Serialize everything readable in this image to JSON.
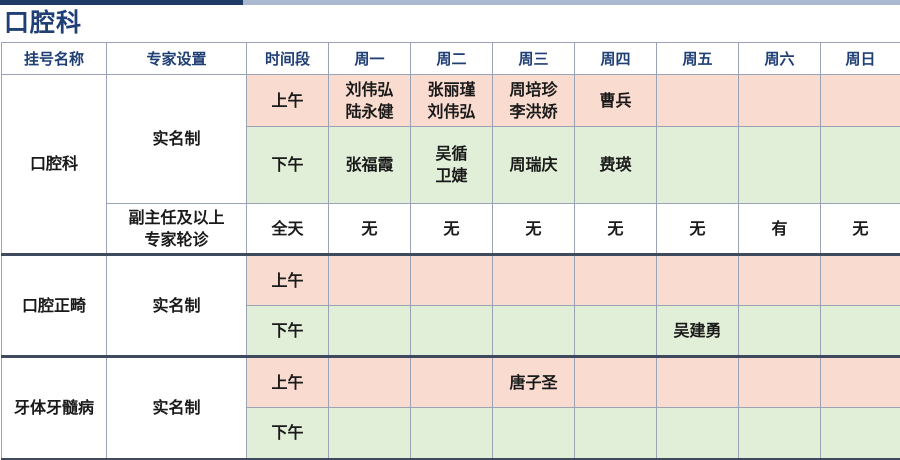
{
  "page_title": "口腔科",
  "headers": [
    "挂号名称",
    "专家设置",
    "时间段",
    "周一",
    "周二",
    "周三",
    "周四",
    "周五",
    "周六",
    "周日"
  ],
  "depts": [
    {
      "name": "口腔科",
      "modes": [
        {
          "mode": "实名制",
          "rows": [
            {
              "slot": "上午",
              "cells": [
                [
                  "刘伟弘",
                  "陆永健"
                ],
                [
                  "张丽瑾",
                  "刘伟弘"
                ],
                [
                  "周培珍",
                  "李洪娇"
                ],
                [
                  "曹兵"
                ],
                [],
                [],
                []
              ]
            },
            {
              "slot": "下午",
              "cells": [
                [
                  "张福霞"
                ],
                [
                  "吴循",
                  "卫婕"
                ],
                [
                  "周瑞庆"
                ],
                [
                  "费瑛"
                ],
                [],
                [],
                []
              ]
            }
          ]
        },
        {
          "mode": "副主任及以上专家轮诊",
          "rows": [
            {
              "slot": "全天",
              "cells": [
                [
                  "无"
                ],
                [
                  "无"
                ],
                [
                  "无"
                ],
                [
                  "无"
                ],
                [
                  "无"
                ],
                [
                  "有"
                ],
                [
                  "无"
                ]
              ]
            }
          ]
        }
      ]
    },
    {
      "name": "口腔正畸",
      "modes": [
        {
          "mode": "实名制",
          "rows": [
            {
              "slot": "上午",
              "cells": [
                [],
                [],
                [],
                [],
                [],
                [],
                []
              ]
            },
            {
              "slot": "下午",
              "cells": [
                [],
                [],
                [],
                [],
                [
                  "吴建勇"
                ],
                [],
                []
              ]
            }
          ]
        }
      ]
    },
    {
      "name": "牙体牙髓病",
      "modes": [
        {
          "mode": "实名制",
          "rows": [
            {
              "slot": "上午",
              "cells": [
                [],
                [],
                [
                  "唐子圣"
                ],
                [],
                [],
                [],
                []
              ]
            },
            {
              "slot": "下午",
              "cells": [
                [],
                [],
                [],
                [],
                [],
                [],
                []
              ]
            }
          ]
        }
      ]
    }
  ]
}
